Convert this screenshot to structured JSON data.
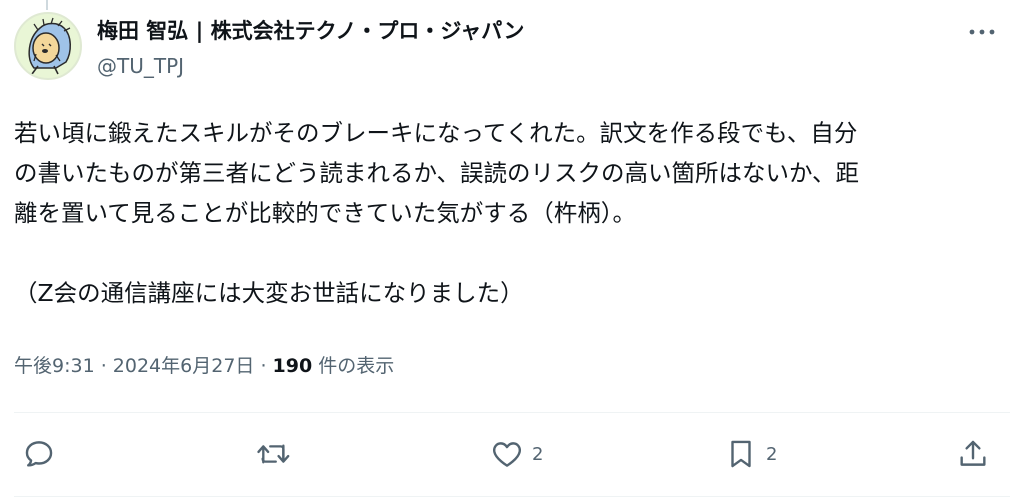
{
  "author": {
    "display_name": "梅田 智弘 | 株式会社テクノ・プロ・ジャパン",
    "handle": "@TU_TPJ",
    "avatar_icon": "hedgehog-avatar-icon"
  },
  "tweet": {
    "lines": [
      "若い頃に鍛えたスキルがそのブレーキになってくれた。訳文を作る段でも、自分",
      "の書いたものが第三者にどう読まれるか、誤読のリスクの高い箇所はないか、距",
      "離を置いて見ることが比較的できていた気がする（杵柄）。",
      "",
      "（Z会の通信講座には大変お世話になりました）"
    ]
  },
  "meta": {
    "time": "午後9:31",
    "separator": " · ",
    "date": "2024年6月27日",
    "views_count": "190",
    "views_label": " 件の表示"
  },
  "actions": {
    "reply": {
      "icon": "reply-icon",
      "count": ""
    },
    "retweet": {
      "icon": "retweet-icon",
      "count": ""
    },
    "like": {
      "icon": "heart-icon",
      "count": "2"
    },
    "bookmark": {
      "icon": "bookmark-icon",
      "count": "2"
    },
    "share": {
      "icon": "share-icon"
    }
  },
  "colors": {
    "text_primary": "#0f1419",
    "text_secondary": "#536471",
    "divider": "#eff3f4"
  }
}
